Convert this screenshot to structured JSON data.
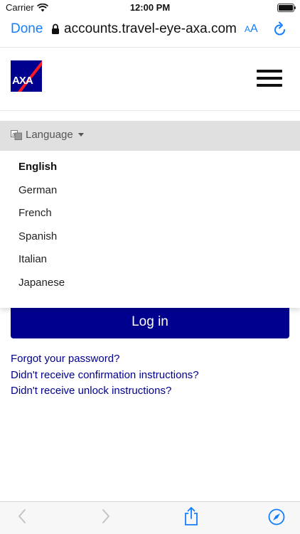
{
  "status": {
    "carrier": "Carrier",
    "time": "12:00 PM",
    "battery_level": 1.0
  },
  "browser": {
    "done_label": "Done",
    "url": "accounts.travel-eye-axa.com",
    "text_size_small": "A",
    "text_size_large": "A",
    "accent_color": "#147efb"
  },
  "site": {
    "logo_text": "AXA",
    "brand_color": "#00008f"
  },
  "language": {
    "button_label": "Language",
    "options": [
      {
        "label": "English",
        "selected": true
      },
      {
        "label": "German",
        "selected": false
      },
      {
        "label": "French",
        "selected": false
      },
      {
        "label": "Spanish",
        "selected": false
      },
      {
        "label": "Italian",
        "selected": false
      },
      {
        "label": "Japanese",
        "selected": false
      }
    ]
  },
  "form": {
    "login_label": "Log in"
  },
  "links": {
    "forgot_password": "Forgot your password?",
    "no_confirmation": "Didn't receive confirmation instructions?",
    "no_unlock": "Didn't receive unlock instructions?"
  },
  "icons": {
    "wifi": "wifi-icon",
    "battery": "battery-icon",
    "lock": "lock-icon",
    "reload": "reload-icon",
    "menu": "hamburger-icon",
    "translate": "translate-icon",
    "back": "back-icon",
    "forward": "forward-icon",
    "share": "share-icon",
    "compass": "compass-icon"
  }
}
